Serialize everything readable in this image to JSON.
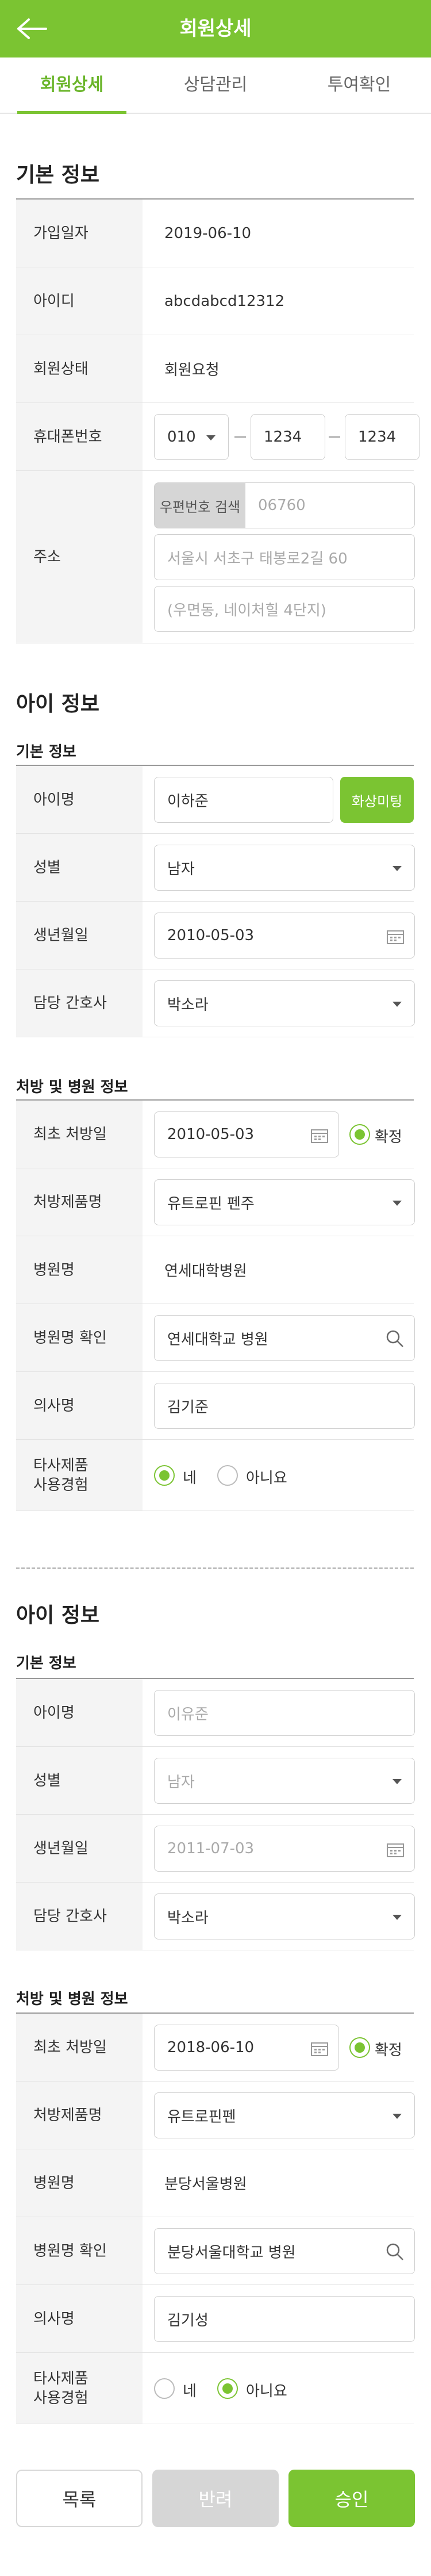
{
  "header": {
    "title": "회원상세"
  },
  "tabs": [
    "회원상세",
    "상담관리",
    "투여확인"
  ],
  "basic": {
    "title": "기본 정보",
    "join_date_label": "가입일자",
    "join_date": "2019-06-10",
    "id_label": "아이디",
    "id": "abcdabcd12312",
    "status_label": "회원상태",
    "status": "회원요청",
    "phone_label": "휴대폰번호",
    "phone1": "010",
    "phone2": "1234",
    "phone3": "1234",
    "address_label": "주소",
    "zip_button": "우편번호 검색",
    "zip": "06760",
    "address1": "서울시 서초구 태봉로2길 60",
    "address2": "(우면동, 네이처힐 4단지)"
  },
  "child1": {
    "title": "아이 정보",
    "basic_sub": "기본 정보",
    "name_label": "아이명",
    "name": "이하준",
    "video_btn": "화상미팅",
    "gender_label": "성별",
    "gender": "남자",
    "birth_label": "생년월일",
    "birth": "2010-05-03",
    "nurse_label": "담당 간호사",
    "nurse": "박소라",
    "rx_sub": "처방 및 병원 정보",
    "first_rx_label": "최초 처방일",
    "first_rx": "2010-05-03",
    "confirm": "확정",
    "product_label": "처방제품명",
    "product": "유트로핀 펜주",
    "hospital_label": "병원명",
    "hospital": "연세대학병원",
    "hospital_confirm_label": "병원명 확인",
    "hospital_confirm": "연세대학교 병원",
    "doctor_label": "의사명",
    "doctor": "김기준",
    "other_label_1": "타사제품",
    "other_label_2": "사용경험",
    "yes": "네",
    "no": "아니요",
    "other_choice": "yes"
  },
  "child2": {
    "title": "아이 정보",
    "basic_sub": "기본 정보",
    "name_label": "아이명",
    "name": "이유준",
    "gender_label": "성별",
    "gender": "남자",
    "birth_label": "생년월일",
    "birth": "2011-07-03",
    "nurse_label": "담당 간호사",
    "nurse": "박소라",
    "rx_sub": "처방 및 병원 정보",
    "first_rx_label": "최초 처방일",
    "first_rx": "2018-06-10",
    "confirm": "확정",
    "product_label": "처방제품명",
    "product": "유트로핀펜",
    "hospital_label": "병원명",
    "hospital": "분당서울병원",
    "hospital_confirm_label": "병원명 확인",
    "hospital_confirm": "분당서울대학교 병원",
    "doctor_label": "의사명",
    "doctor": "김기성",
    "other_label_1": "타사제품",
    "other_label_2": "사용경험",
    "yes": "네",
    "no": "아니요",
    "other_choice": "no"
  },
  "footer": {
    "list": "목록",
    "reject": "반려",
    "approve": "승인"
  },
  "colors": {
    "primary": "#7bc432",
    "label_bg": "#f4f4f4",
    "reject_bg": "#d6d6d6"
  }
}
